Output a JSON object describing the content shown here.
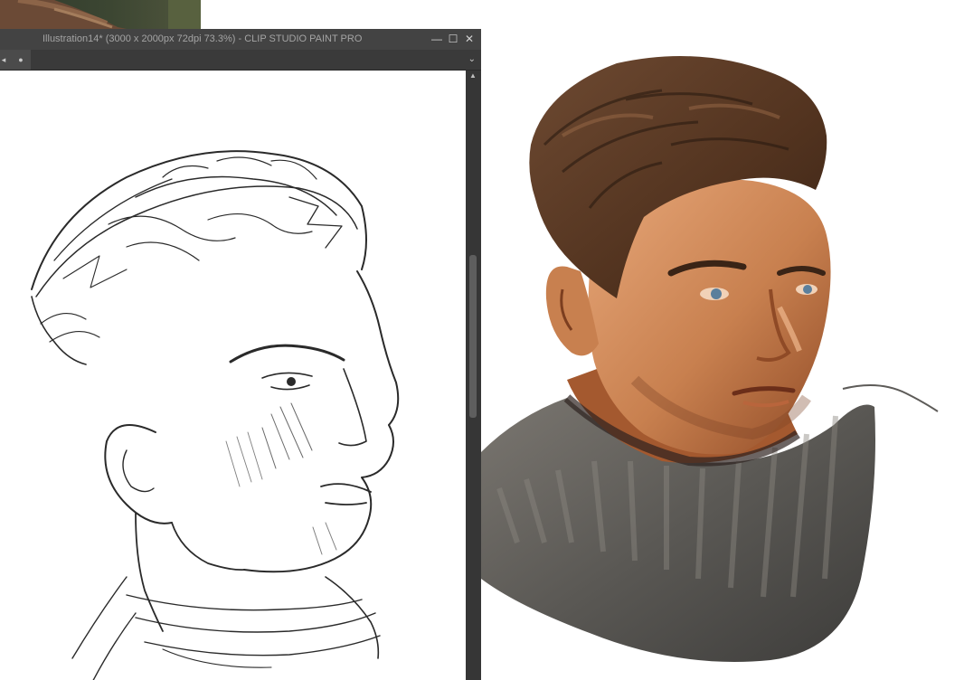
{
  "window": {
    "title": "Illustration14* (3000 x 2000px 72dpi 73.3%)  - CLIP STUDIO PAINT PRO",
    "minimize_glyph": "—",
    "maximize_glyph": "☐",
    "close_glyph": "✕"
  },
  "tabbar": {
    "left_arrow": "◂",
    "tab_dot": "●",
    "chevron": "⌄"
  },
  "scrollbar": {
    "up_arrow": "▲"
  },
  "colors": {
    "titlebar_bg": "#434343",
    "title_text": "#a4a4a4",
    "tabbar_bg": "#3a3a3a",
    "scrollbar_bg": "#363636",
    "skin_base": "#cf8c5c",
    "hair": "#5a3a24",
    "sweater": "#5d5b58",
    "sketch_line": "#2a2a2a"
  }
}
